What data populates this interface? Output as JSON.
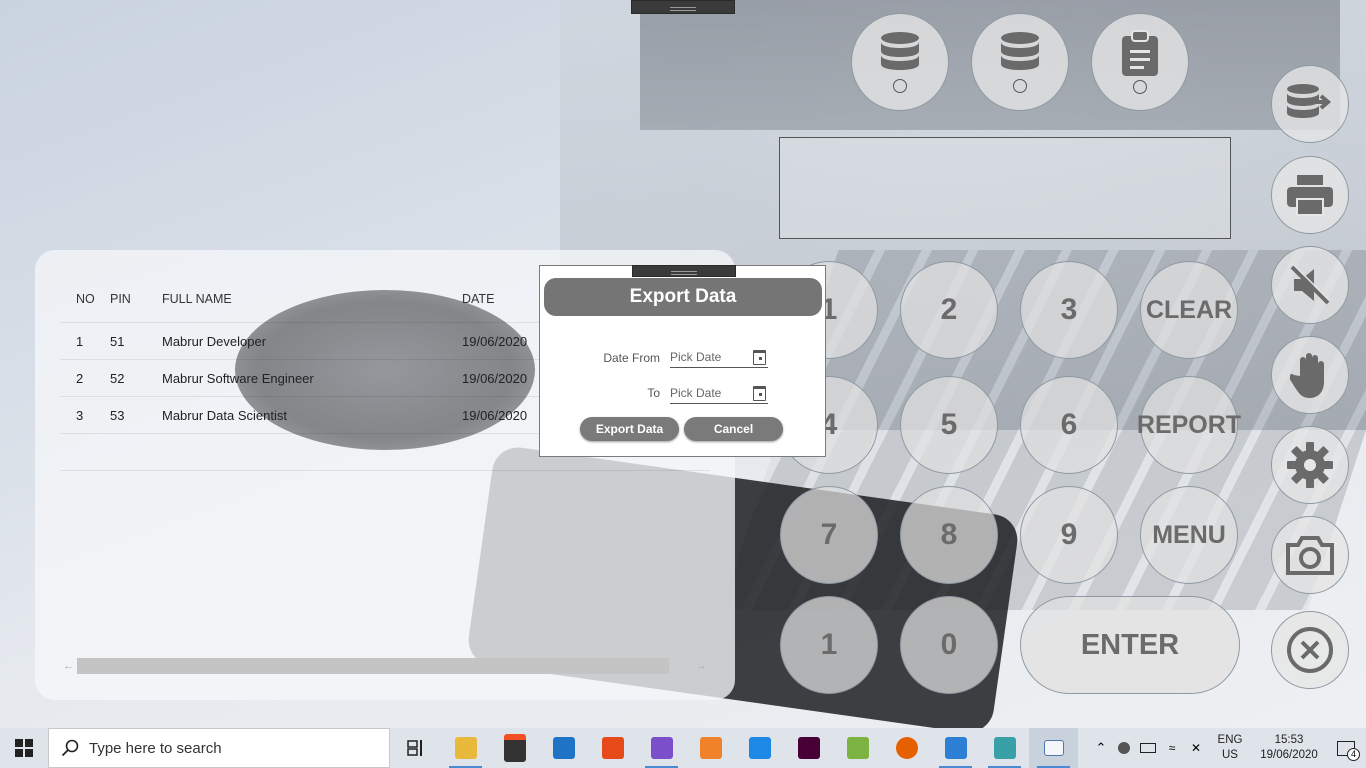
{
  "table": {
    "headers": {
      "no": "NO",
      "pin": "PIN",
      "name": "FULL NAME",
      "date": "DATE"
    },
    "rows": [
      {
        "no": "1",
        "pin": "51",
        "name": "Mabrur Developer",
        "date": "19/06/2020"
      },
      {
        "no": "2",
        "pin": "52",
        "name": "Mabrur Software Engineer",
        "date": "19/06/2020"
      },
      {
        "no": "3",
        "pin": "53",
        "name": "Mabrur Data Scientist",
        "date": "19/06/2020"
      }
    ]
  },
  "dialog": {
    "title": "Export Data",
    "date_from_label": "Date From",
    "to_label": "To",
    "date_from_placeholder": "Pick Date",
    "to_placeholder": "Pick Date",
    "export_button": "Export Data",
    "cancel_button": "Cancel"
  },
  "keypad": {
    "k1": "1",
    "k2": "2",
    "k3": "3",
    "clear": "CLEAR",
    "k4": "4",
    "k5": "5",
    "k6": "6",
    "report": "REPORT",
    "k7": "7",
    "k8": "8",
    "k9": "9",
    "menu": "MENU",
    "k1b": "1",
    "k0": "0",
    "enter": "ENTER"
  },
  "top_buttons": [
    {
      "icon": "database-icon"
    },
    {
      "icon": "database-icon"
    },
    {
      "icon": "clipboard-icon"
    }
  ],
  "side_buttons": [
    "database-export-icon",
    "printer-icon",
    "mute-icon",
    "hand-icon",
    "gear-icon",
    "camera-icon",
    "close-circle-icon"
  ],
  "taskbar": {
    "search_placeholder": "Type here to search",
    "lang_line1": "ENG",
    "lang_line2": "US",
    "time": "15:53",
    "date": "19/06/2020",
    "notification_count": "4"
  },
  "colors": {
    "accent": "#757575",
    "button_text": "#6b6b6b",
    "taskbar": "#dfe3ea"
  }
}
